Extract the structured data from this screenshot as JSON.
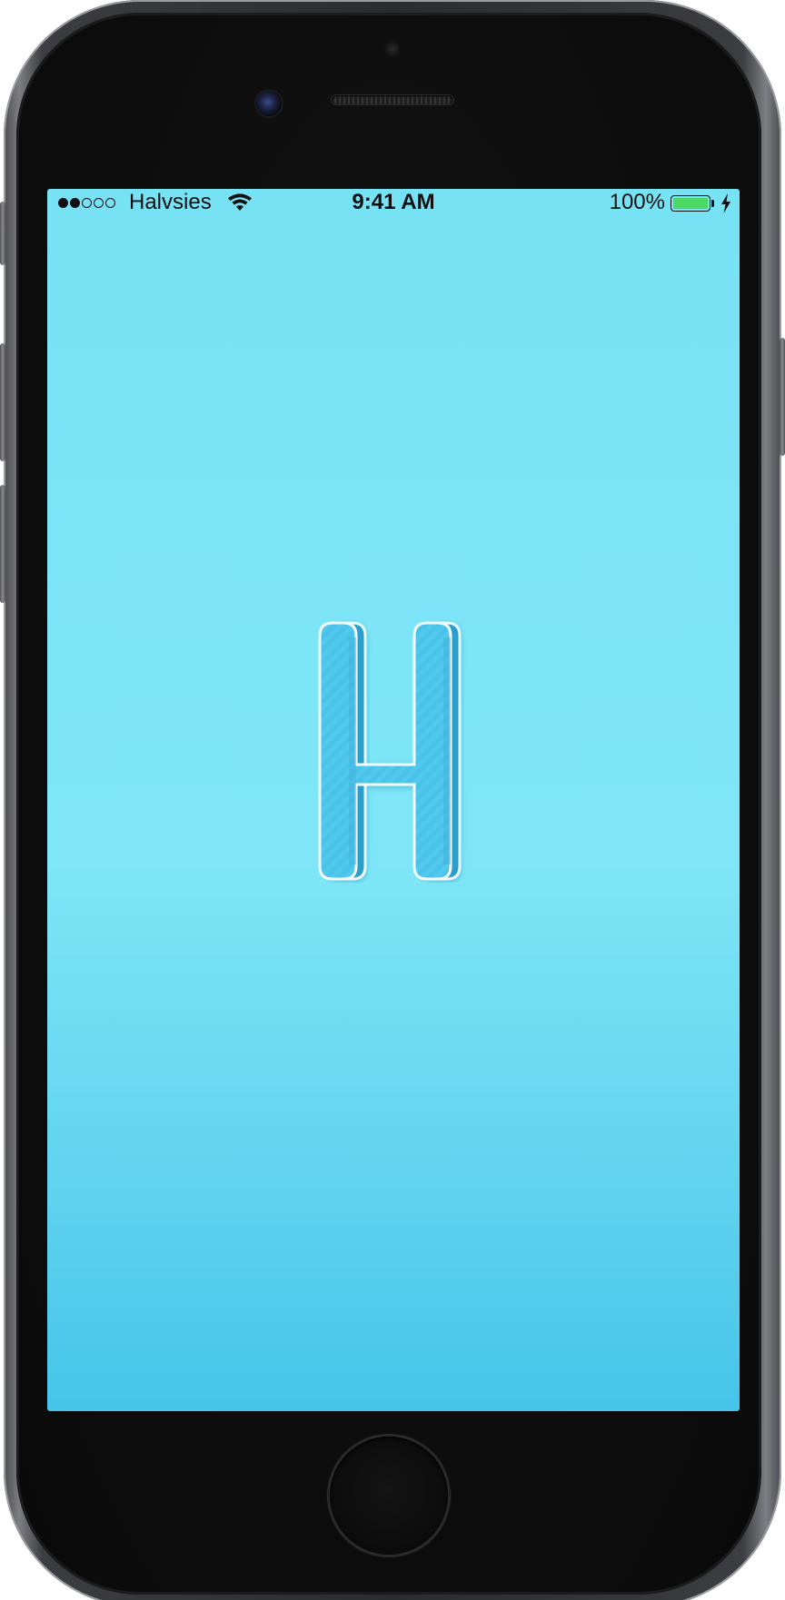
{
  "status_bar": {
    "signal_bars": 2,
    "signal_total": 5,
    "carrier": "Halvsies",
    "time": "9:41 AM",
    "battery_percent": "100%",
    "battery_level": 1.0,
    "charging": true
  },
  "splash": {
    "logo_icon": "letter-h-logo",
    "background_colors": [
      "#78e2f5",
      "#46c4e9"
    ],
    "logo_color": "#4ac3ea"
  },
  "device": {
    "model": "iphone-6",
    "color": "space-gray"
  }
}
